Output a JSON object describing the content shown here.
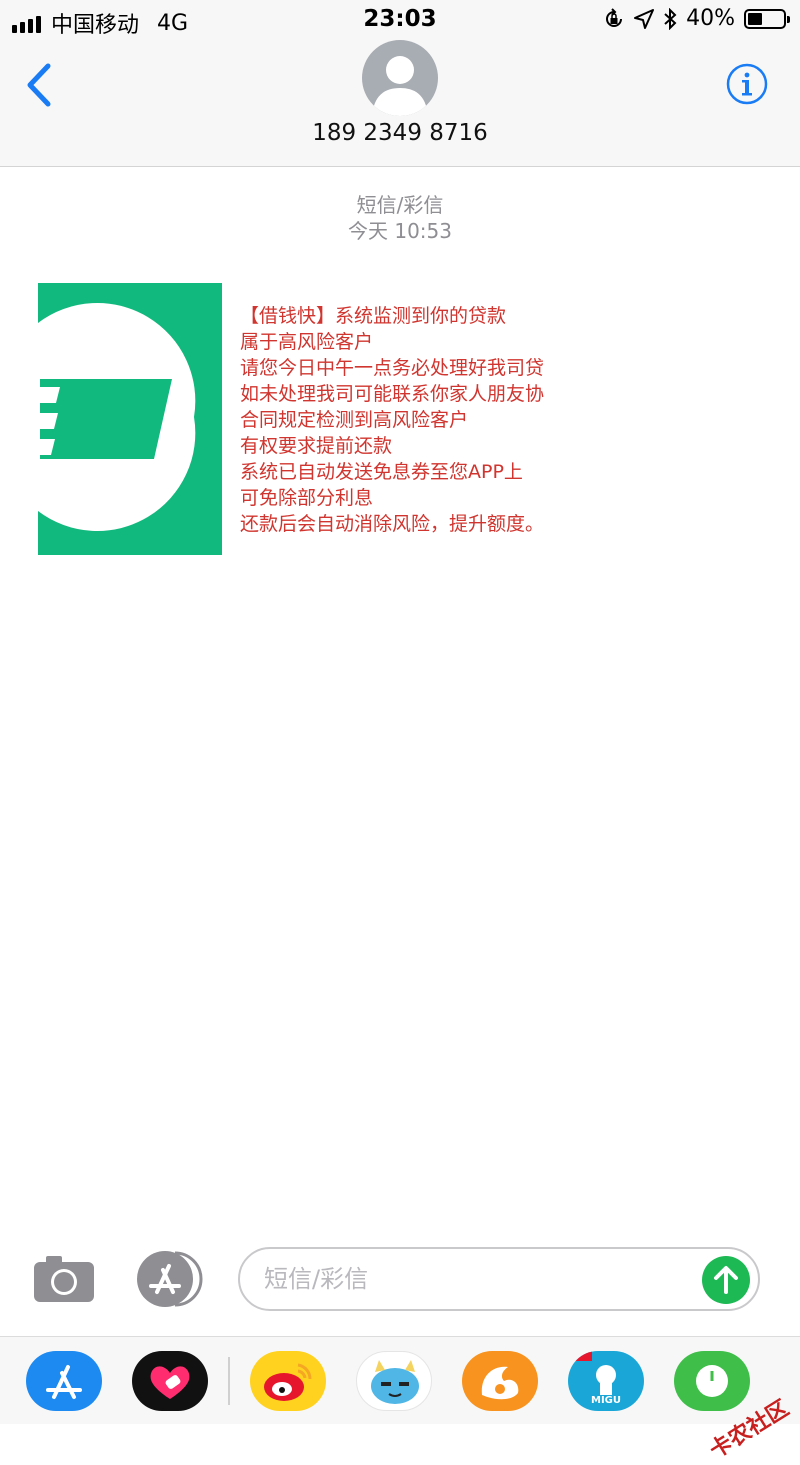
{
  "status": {
    "carrier": "中国移动",
    "network": "4G",
    "time": "23:03",
    "battery": "40%"
  },
  "header": {
    "contact": "189 2349 8716"
  },
  "thread": {
    "type": "短信/彩信",
    "time": "今天 10:53"
  },
  "message": {
    "lines": [
      "【借钱快】系统监测到你的贷款",
      "属于高风险客户",
      "请您今日中午一点务必处理好我司贷",
      "如未处理我司可能联系你家人朋友协",
      "合同规定检测到高风险客户",
      "有权要求提前还款",
      "系统已自动发送免息券至您APP上",
      "可免除部分利息",
      "还款后会自动消除风险，提升额度。"
    ]
  },
  "composer": {
    "placeholder": "短信/彩信"
  },
  "drawer": {
    "migu_label": "MIGU"
  },
  "watermark": "卡农社区",
  "colors": {
    "accent": "#1a7cf5",
    "send": "#1db954",
    "logo_green": "#12b97e",
    "message_text": "#d0352f"
  }
}
